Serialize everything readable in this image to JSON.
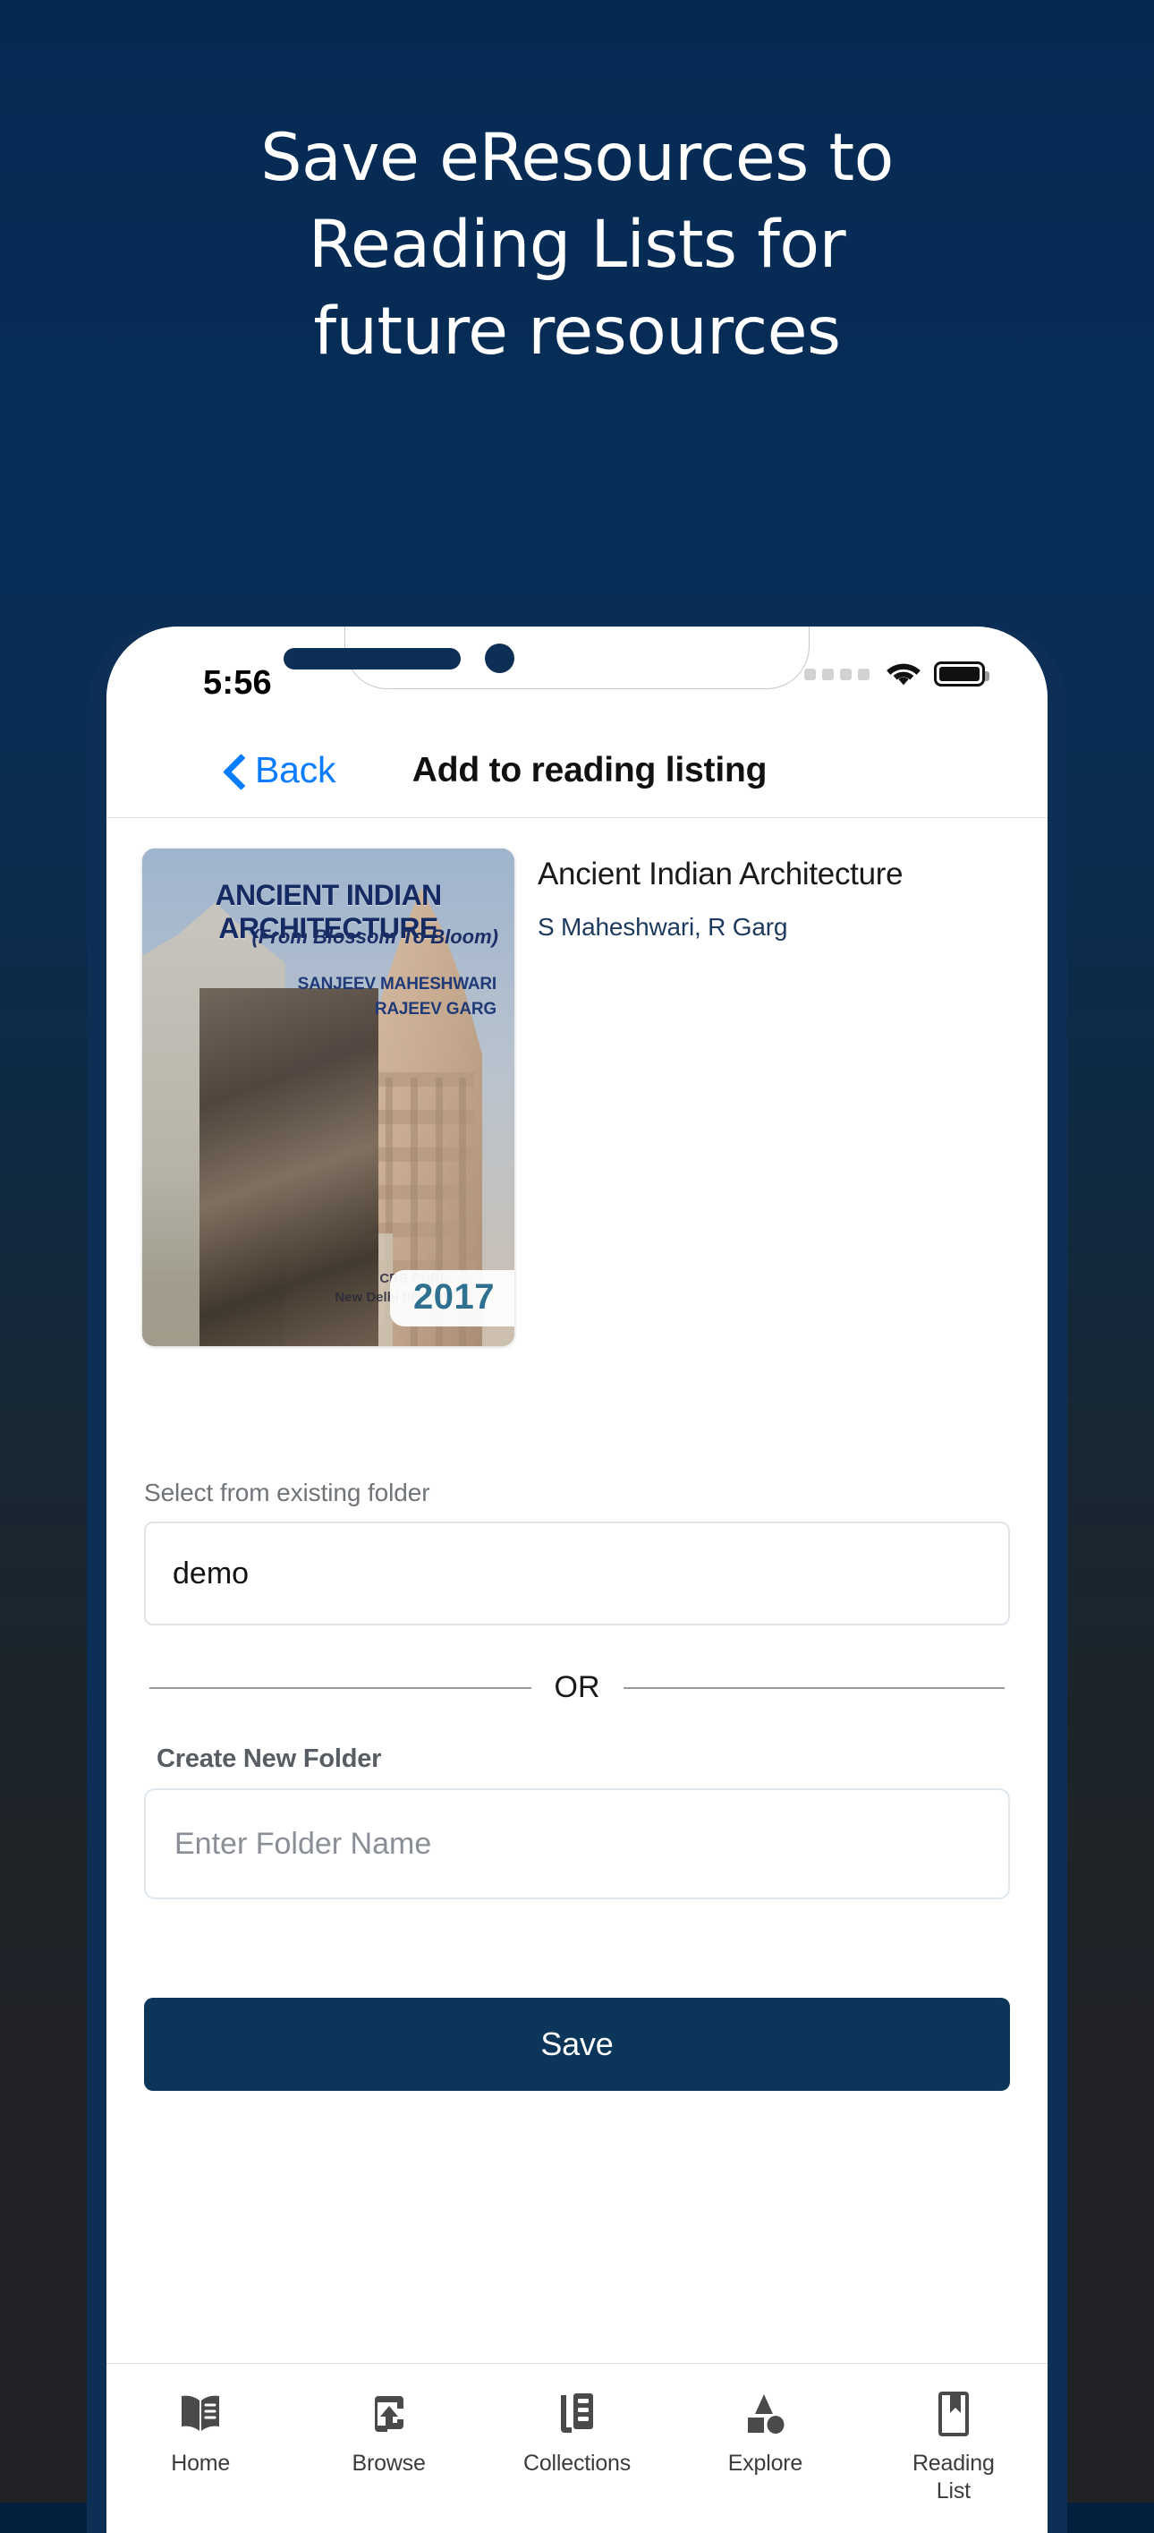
{
  "promo": {
    "headline": "Save eResources to\nReading Lists for\nfuture resources",
    "bg_top_color": "#062c55",
    "bg_bottom_color": "#212226"
  },
  "phone": {
    "status_bar": {
      "time": "5:56",
      "wifi_icon": "wifi-icon",
      "battery_icon": "battery-full-icon",
      "signal_icon": "signal-dots-icon"
    },
    "nav": {
      "back_label": "Back",
      "back_icon": "chevron-left-icon",
      "title": "Add to reading listing",
      "back_color": "#0a7cff"
    },
    "book": {
      "title": "Ancient Indian Architecture",
      "authors": "S Maheshwari,  R Garg",
      "year_badge": "2017",
      "cover": {
        "title": "ANCIENT INDIAN ARCHITECTURE",
        "subtitle": "(From Blossom To Bloom)",
        "authors": "SANJEEV MAHESHWARI\nRAJEEV GARG",
        "publisher": "CBS PUBL\nNew Delhi (INDIA)"
      }
    },
    "form": {
      "select_label": "Select from existing folder",
      "select_value": "demo",
      "divider_text": "OR",
      "create_label": "Create New Folder",
      "folder_placeholder": "Enter Folder Name",
      "folder_value": "",
      "save_label": "Save",
      "save_color": "#0b3559"
    },
    "tabs": [
      {
        "label": "Home",
        "icon": "open-book-icon"
      },
      {
        "label": "Browse",
        "icon": "upload-box-icon"
      },
      {
        "label": "Collections",
        "icon": "stacked-documents-icon"
      },
      {
        "label": "Explore",
        "icon": "shapes-icon"
      },
      {
        "label": "Reading\nList",
        "icon": "bookmark-icon"
      }
    ]
  }
}
